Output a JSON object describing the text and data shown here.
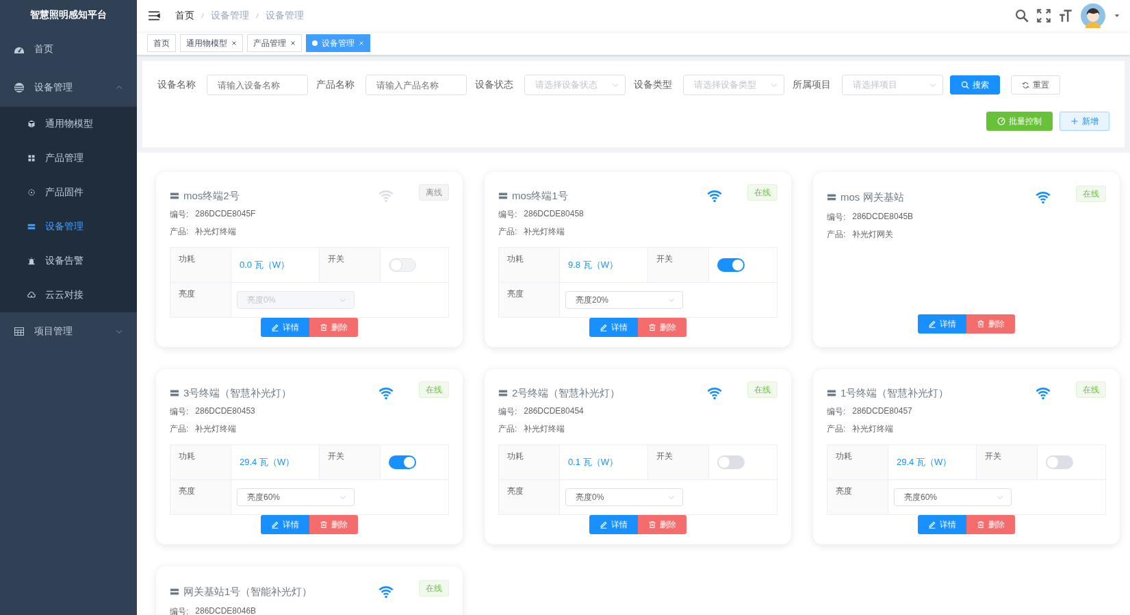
{
  "sidebar": {
    "title": "智慧照明感知平台",
    "items": [
      {
        "label": "首页"
      },
      {
        "label": "设备管理",
        "expanded": true,
        "children": [
          {
            "label": "通用物模型",
            "selected": false
          },
          {
            "label": "产品管理",
            "selected": false
          },
          {
            "label": "产品固件",
            "selected": false
          },
          {
            "label": "设备管理",
            "selected": true
          },
          {
            "label": "设备告警",
            "selected": false
          },
          {
            "label": "云云对接",
            "selected": false
          }
        ]
      },
      {
        "label": "项目管理",
        "expanded": false
      }
    ]
  },
  "breadcrumb": [
    "首页",
    "设备管理",
    "设备管理"
  ],
  "tags": [
    {
      "label": "首页",
      "closable": false,
      "selected": false
    },
    {
      "label": "通用物模型",
      "closable": true,
      "selected": false
    },
    {
      "label": "产品管理",
      "closable": true,
      "selected": false
    },
    {
      "label": "设备管理",
      "closable": true,
      "selected": true
    }
  ],
  "filters": [
    {
      "label": "设备名称",
      "kind": "input",
      "placeholder": "请输入设备名称"
    },
    {
      "label": "产品名称",
      "kind": "input",
      "placeholder": "请输入产品名称"
    },
    {
      "label": "设备状态",
      "kind": "select",
      "placeholder": "请选择设备状态"
    },
    {
      "label": "设备类型",
      "kind": "select",
      "placeholder": "请选择设备类型"
    },
    {
      "label": "所属项目",
      "kind": "select",
      "placeholder": "请选择项目"
    }
  ],
  "filter_buttons": [
    {
      "label": "搜索",
      "kind": "primary"
    },
    {
      "label": "重置",
      "kind": "plain"
    }
  ],
  "actions": [
    {
      "label": "批量控制",
      "kind": "success"
    },
    {
      "label": "新增",
      "kind": "add"
    }
  ],
  "devices": [
    {
      "name": "mos终端2号",
      "code_label": "编号:",
      "code": "286DCDE8045F",
      "product_label": "产品:",
      "product": "补光灯终端",
      "online": false,
      "status": "离线",
      "controls": {
        "power_label": "功耗",
        "power": "0.0 瓦（W）",
        "switch_label": "开关",
        "switch_on": false,
        "disabled": true,
        "brightness_label": "亮度",
        "brightness": "亮度0%"
      },
      "buttons": [
        "详情",
        "删除"
      ]
    },
    {
      "name": "mos终端1号",
      "code_label": "编号:",
      "code": "286DCDE80458",
      "product_label": "产品:",
      "product": "补光灯终端",
      "online": true,
      "status": "在线",
      "controls": {
        "power_label": "功耗",
        "power": "9.8 瓦（W）",
        "switch_label": "开关",
        "switch_on": true,
        "disabled": false,
        "brightness_label": "亮度",
        "brightness": "亮度20%"
      },
      "buttons": [
        "详情",
        "删除"
      ]
    },
    {
      "name": "mos 网关基站",
      "code_label": "编号:",
      "code": "286DCDE8045B",
      "product_label": "产品:",
      "product": "补光灯网关",
      "online": true,
      "status": "在线",
      "buttons": [
        "详情",
        "删除"
      ]
    },
    {
      "name": "3号终端（智慧补光灯）",
      "code_label": "编号:",
      "code": "286DCDE80453",
      "product_label": "产品:",
      "product": "补光灯终端",
      "online": true,
      "status": "在线",
      "controls": {
        "power_label": "功耗",
        "power": "29.4 瓦（W）",
        "switch_label": "开关",
        "switch_on": true,
        "disabled": false,
        "brightness_label": "亮度",
        "brightness": "亮度60%"
      },
      "buttons": [
        "详情",
        "删除"
      ]
    },
    {
      "name": "2号终端（智慧补光灯）",
      "code_label": "编号:",
      "code": "286DCDE80454",
      "product_label": "产品:",
      "product": "补光灯终端",
      "online": true,
      "status": "在线",
      "controls": {
        "power_label": "功耗",
        "power": "0.1 瓦（W）",
        "switch_label": "开关",
        "switch_on": false,
        "disabled": false,
        "brightness_label": "亮度",
        "brightness": "亮度0%"
      },
      "buttons": [
        "详情",
        "删除"
      ]
    },
    {
      "name": "1号终端（智慧补光灯）",
      "code_label": "编号:",
      "code": "286DCDE80457",
      "product_label": "产品:",
      "product": "补光灯终端",
      "online": true,
      "status": "在线",
      "controls": {
        "power_label": "功耗",
        "power": "29.4 瓦（W）",
        "switch_label": "开关",
        "switch_on": false,
        "disabled": false,
        "brightness_label": "亮度",
        "brightness": "亮度60%"
      },
      "buttons": [
        "详情",
        "删除"
      ]
    },
    {
      "name": "网关基站1号（智能补光灯）",
      "code_label": "编号:",
      "code": "286DCDE8046B",
      "online": true,
      "status": "在线"
    }
  ]
}
